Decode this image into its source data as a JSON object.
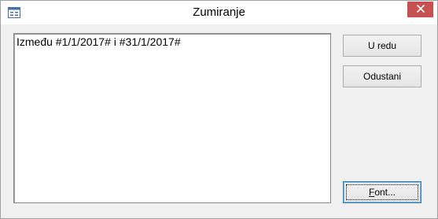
{
  "window": {
    "title": "Zumiranje"
  },
  "icons": {
    "app": "form-window-icon",
    "close": "close-icon",
    "close_color": "#c75050"
  },
  "editor": {
    "value": "Između #1/1/2017# i #31/1/2017#"
  },
  "buttons": {
    "ok_label": "U redu",
    "cancel_label": "Odustani",
    "font_accel": "F",
    "font_rest": "ont..."
  }
}
